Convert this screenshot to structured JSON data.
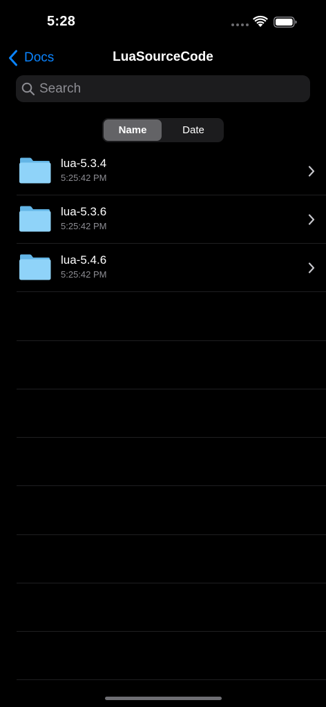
{
  "status_bar": {
    "time": "5:28"
  },
  "nav": {
    "back_label": "Docs",
    "title": "LuaSourceCode"
  },
  "search": {
    "placeholder": "Search",
    "value": ""
  },
  "sort": {
    "options": [
      "Name",
      "Date"
    ],
    "selected": "Name"
  },
  "files": [
    {
      "name": "lua-5.3.4",
      "date": "5:25:42 PM",
      "icon": "folder-icon"
    },
    {
      "name": "lua-5.3.6",
      "date": "5:25:42 PM",
      "icon": "folder-icon"
    },
    {
      "name": "lua-5.4.6",
      "date": "5:25:42 PM",
      "icon": "folder-icon"
    }
  ],
  "colors": {
    "accent": "#0a84ff",
    "background": "#000000",
    "folder": "#8fd3f9",
    "secondary_text": "#8d8d93"
  }
}
